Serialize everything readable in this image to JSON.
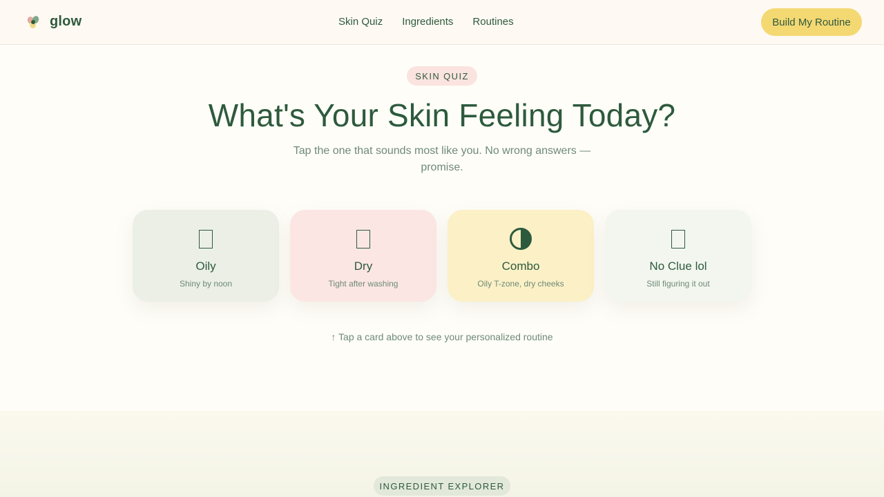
{
  "header": {
    "brand": "glow",
    "nav": [
      "Skin Quiz",
      "Ingredients",
      "Routines"
    ],
    "cta_label": "Build My Routine"
  },
  "hero": {
    "badge": "SKIN QUIZ",
    "title": "What's Your Skin Feeling Today?",
    "subtitle": "Tap the one that sounds most like you. No wrong answers — promise."
  },
  "cards": [
    {
      "icon": "missing-glyph-icon",
      "title": "Oily",
      "desc": "Shiny by noon",
      "color": "#ebefe6"
    },
    {
      "icon": "missing-glyph-icon",
      "title": "Dry",
      "desc": "Tight after washing",
      "color": "#fbe6e3"
    },
    {
      "icon": "half-circle-icon",
      "title": "Combo",
      "desc": "Oily T-zone, dry cheeks",
      "color": "#fbf0c6"
    },
    {
      "icon": "missing-glyph-icon",
      "title": "No Clue lol",
      "desc": "Still figuring it out",
      "color": "#f2f6ee"
    }
  ],
  "hint": "↑ Tap a card above to see your personalized routine",
  "next_section": {
    "badge": "INGREDIENT EXPLORER"
  },
  "colors": {
    "accent": "#f4d872",
    "text": "#2d5a3d",
    "muted": "#6e8a76",
    "background": "#fffdf8"
  }
}
